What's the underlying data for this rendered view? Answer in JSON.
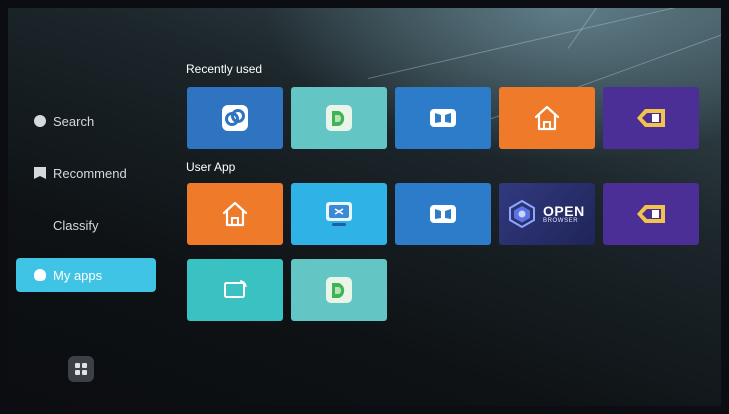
{
  "sidebar": {
    "items": [
      {
        "label": "Search",
        "icon": "search-icon"
      },
      {
        "label": "Recommend",
        "icon": "bookmark-icon"
      },
      {
        "label": "Classify",
        "icon": "classify-icon"
      },
      {
        "label": "My apps",
        "icon": "my-apps-icon",
        "active": true
      }
    ],
    "bottom_button_icon": "grid-icon"
  },
  "sections": {
    "recent_title": "Recently used",
    "user_title": "User App"
  },
  "recent_apps": [
    {
      "icon": "link-app-icon",
      "color": "#2f74c0"
    },
    {
      "icon": "green-d-app-icon",
      "color": "#63c6c4"
    },
    {
      "icon": "media-bars-app-icon",
      "color": "#2d7cc9"
    },
    {
      "icon": "home-app-icon",
      "color": "#ef7a2a"
    },
    {
      "icon": "diamond-app-icon",
      "color": "#4b2f97"
    }
  ],
  "user_apps": [
    {
      "icon": "home-app-icon",
      "color": "#ef7a2a"
    },
    {
      "icon": "monitor-app-icon",
      "color": "#2fb3e6"
    },
    {
      "icon": "media-bars-app-icon",
      "color": "#2d7cc9"
    },
    {
      "icon": "open-browser-app-icon",
      "color": "#2a3070",
      "label": "OPEN",
      "sublabel": "BROWSER"
    },
    {
      "icon": "diamond-app-icon",
      "color": "#4b2f97"
    },
    {
      "icon": "cast-app-icon",
      "color": "#3ac2c2"
    },
    {
      "icon": "green-d-app-icon",
      "color": "#63c6c4"
    }
  ]
}
